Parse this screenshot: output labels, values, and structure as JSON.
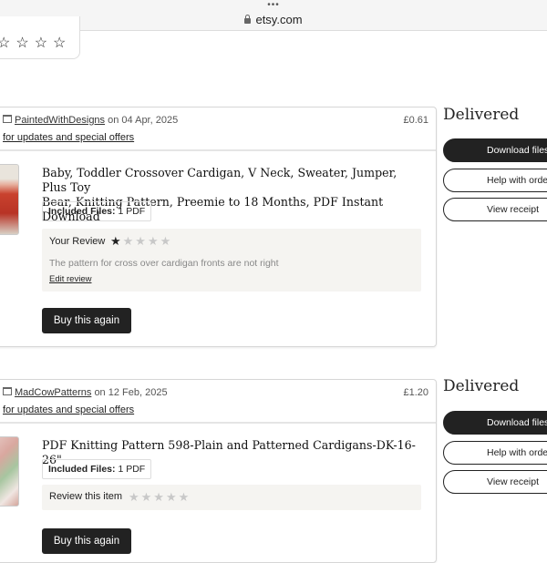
{
  "browser": {
    "url": "etsy.com"
  },
  "review_stub": {
    "stars": "☆☆☆☆"
  },
  "orders": [
    {
      "shop_name": "PaintedWithDesigns",
      "date_prefix": "on 04 Apr, 2025",
      "price": "£0.61",
      "updates_link": "for updates and special offers",
      "title_line1": "Baby, Toddler Crossover Cardigan, V Neck, Sweater, Jumper, Plus Toy",
      "title_line2": "Bear, Knitting Pattern, Preemie to 18 Months, PDF Instant Download",
      "files_label": "Included Files:",
      "files_value": "1 PDF",
      "review_label": "Your Review",
      "rating": "1 of 5",
      "review_text": "The pattern for cross over cardigan fronts are not right",
      "edit_review": "Edit review",
      "buy_again": "Buy this again",
      "status": "Delivered",
      "actions": [
        "Download files",
        "Help with order",
        "View receipt"
      ]
    },
    {
      "shop_name": "MadCowPatterns",
      "date_prefix": "on 12 Feb, 2025",
      "price": "£1.20",
      "updates_link": "for updates and special offers",
      "title_line1": "PDF Knitting Pattern 598-Plain and Patterned Cardigans-DK-16-26\"",
      "files_label": "Included Files:",
      "files_value": "1 PDF",
      "review_label": "Review this item",
      "rating": "0 of 5",
      "buy_again": "Buy this again",
      "status": "Delivered",
      "actions": [
        "Download files",
        "Help with order",
        "View receipt"
      ]
    }
  ]
}
